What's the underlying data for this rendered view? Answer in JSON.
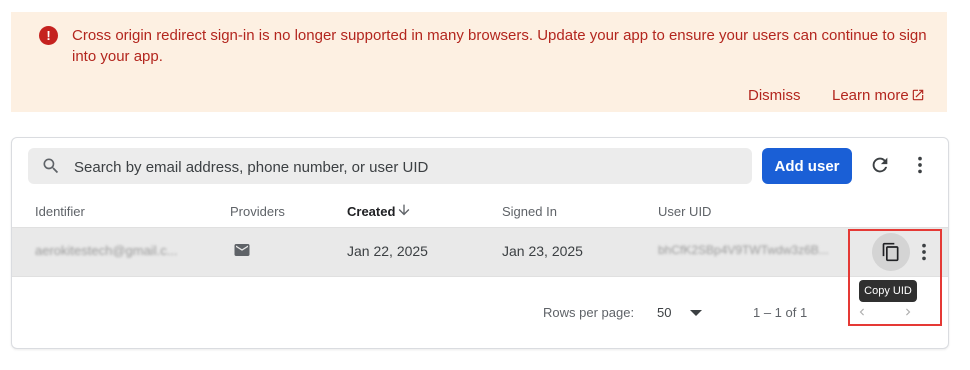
{
  "banner": {
    "icon": "error-icon",
    "message": "Cross origin redirect sign-in is no longer supported in many browsers. Update your app to ensure your users can continue to sign into your app.",
    "dismiss_label": "Dismiss",
    "learn_more_label": "Learn more",
    "accent_color": "#b3261e",
    "background_color": "#fdf0e2"
  },
  "toolbar": {
    "search_placeholder": "Search by email address, phone number, or user UID",
    "add_user_label": "Add user",
    "add_user_color": "#1a5fd6"
  },
  "table": {
    "columns": [
      "Identifier",
      "Providers",
      "Created",
      "Signed In",
      "User UID"
    ],
    "sorted_column": "Created",
    "sort_direction": "descending",
    "rows": [
      {
        "identifier": "aerokitestech@gmail.c...",
        "provider": "email-icon",
        "created": "Jan 22, 2025",
        "signed_in": "Jan 23, 2025",
        "uid": "bhCfK2SBp4V9TWTwdw3z6B..."
      }
    ]
  },
  "tooltip": {
    "copy_uid": "Copy UID"
  },
  "pagination": {
    "rows_per_page_label": "Rows per page:",
    "rows_per_page_value": "50",
    "range": "1 – 1 of 1"
  }
}
